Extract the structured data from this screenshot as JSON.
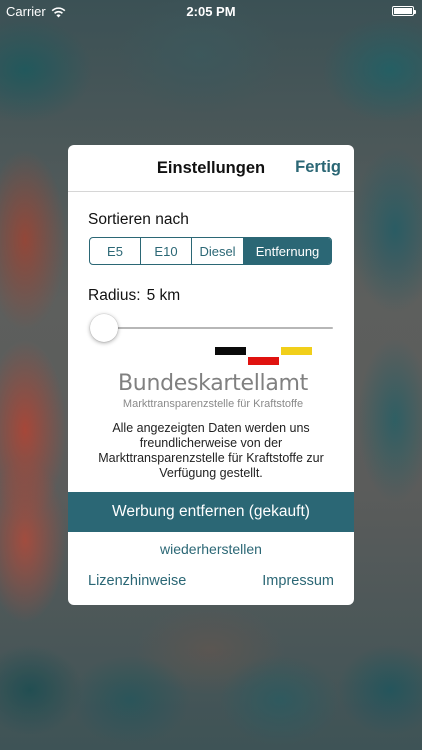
{
  "status_bar": {
    "carrier": "Carrier",
    "time": "2:05 PM",
    "icons": [
      "wifi-icon",
      "battery-icon"
    ]
  },
  "dialog": {
    "title": "Einstellungen",
    "done_label": "Fertig",
    "sort": {
      "label": "Sortieren nach",
      "options": [
        "E5",
        "E10",
        "Diesel",
        "Entfernung"
      ],
      "selected": "Entfernung"
    },
    "radius": {
      "label": "Radius:",
      "value": "5 km",
      "slider_level": 0
    },
    "logo": {
      "name": "Bundeskartellamt",
      "subtitle": "Markttransparenzstelle für Kraftstoffe",
      "flag_colors": [
        "#0a0a0a",
        "#e0120f",
        "#f1cf1a"
      ]
    },
    "info_text": "Alle angezeigten Daten werden uns freundlicherweise von der Markttransparenzstelle für Kraftstoffe zur Verfügung gestellt.",
    "purchase_label": "Werbung entfernen (gekauft)",
    "restore_label": "wiederherstellen",
    "license_label": "Lizenzhinweise",
    "imprint_label": "Impressum"
  },
  "colors": {
    "accent": "#2b6775"
  }
}
